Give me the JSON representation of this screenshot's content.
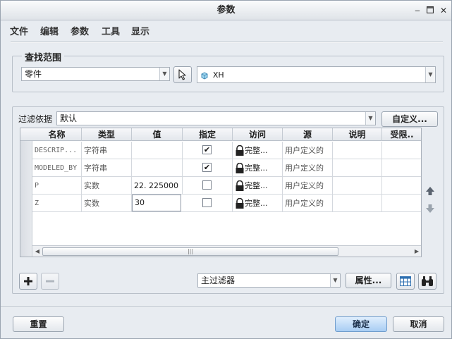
{
  "window": {
    "title": "参数"
  },
  "menu": [
    "文件",
    "编辑",
    "参数",
    "工具",
    "显示"
  ],
  "lookin": {
    "legend": "查找范围",
    "type_value": "零件",
    "object_value": "XH"
  },
  "filter": {
    "label": "过滤依据",
    "value": "默认",
    "customize_label": "自定义..."
  },
  "table": {
    "columns": [
      "名称",
      "类型",
      "值",
      "指定",
      "访问",
      "源",
      "说明",
      "受限.."
    ],
    "rows": [
      {
        "name": "DESCRIP...",
        "type": "字符串",
        "value": "",
        "designate": true,
        "access": "完整...",
        "source": "用户定义的"
      },
      {
        "name": "MODELED_BY",
        "type": "字符串",
        "value": "",
        "designate": true,
        "access": "完整...",
        "source": "用户定义的"
      },
      {
        "name": "P",
        "type": "实数",
        "value": "22. 225000",
        "designate": false,
        "access": "完整...",
        "source": "用户定义的"
      },
      {
        "name": "Z",
        "type": "实数",
        "value": "30",
        "designate": false,
        "access": "完整...",
        "source": "用户定义的"
      }
    ]
  },
  "toolbar": {
    "main_filter": "主过滤器",
    "properties_label": "属性..."
  },
  "footer": {
    "reset_label": "重置",
    "ok_label": "确定",
    "cancel_label": "取消"
  },
  "colors": {
    "primary_button": "#a8cdf3",
    "arrow_icon": "#6b7480"
  }
}
